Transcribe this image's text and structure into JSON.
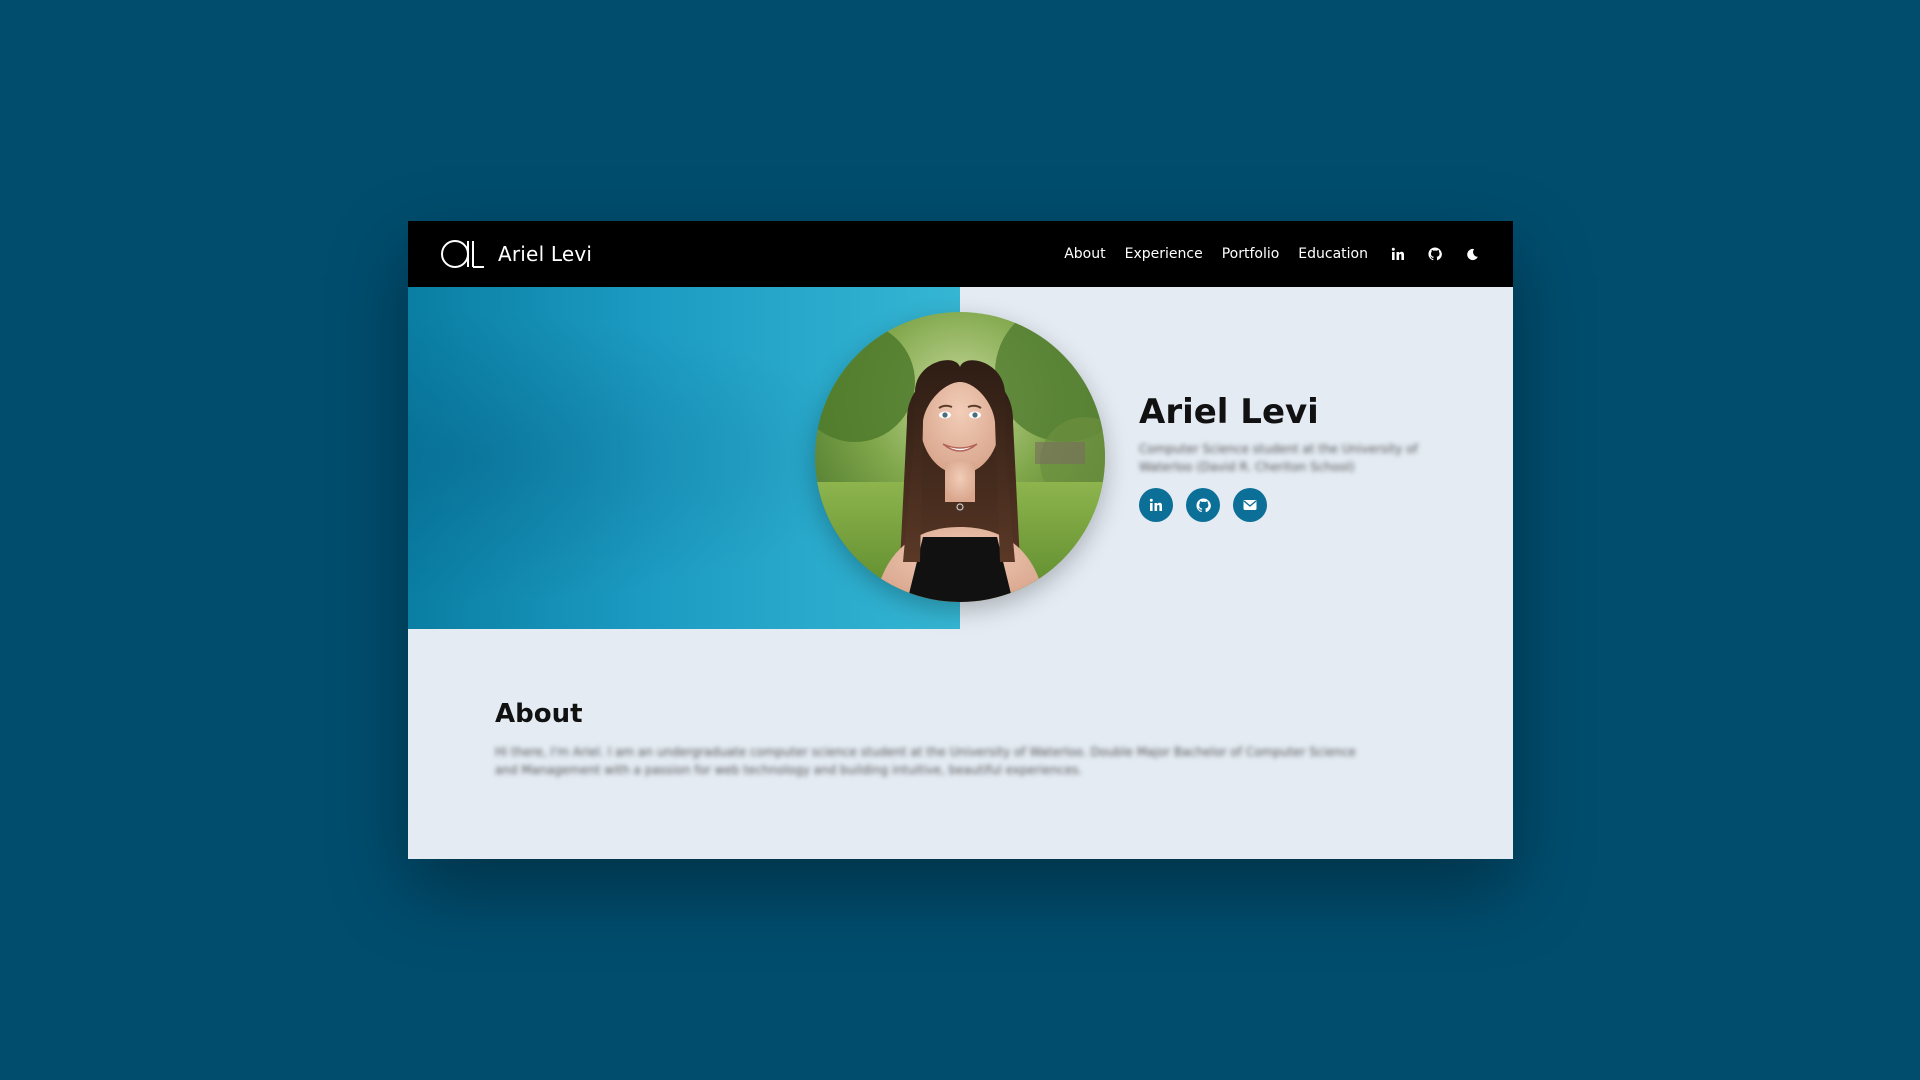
{
  "navbar": {
    "brand_name": "Ariel Levi",
    "links": [
      "About",
      "Experience",
      "Portfolio",
      "Education"
    ],
    "icons": [
      "linkedin-icon",
      "github-icon",
      "moon-icon"
    ]
  },
  "hero": {
    "name": "Ariel Levi",
    "subtitle": "Computer Science student at the University of Waterloo (David R. Cheriton School)",
    "social": [
      "linkedin-icon",
      "github-icon",
      "email-icon"
    ]
  },
  "about": {
    "title": "About",
    "body": "Hi there, I'm Ariel. I am an undergraduate computer science student at the University of Waterloo. Double Major Bachelor of Computer Science and Management with a passion for web technology and building intuitive, beautiful experiences."
  },
  "colors": {
    "page_background": "#004d6e",
    "navbar": "#000000",
    "accent": "#0b6f98",
    "content_background": "#e4ebf3"
  }
}
